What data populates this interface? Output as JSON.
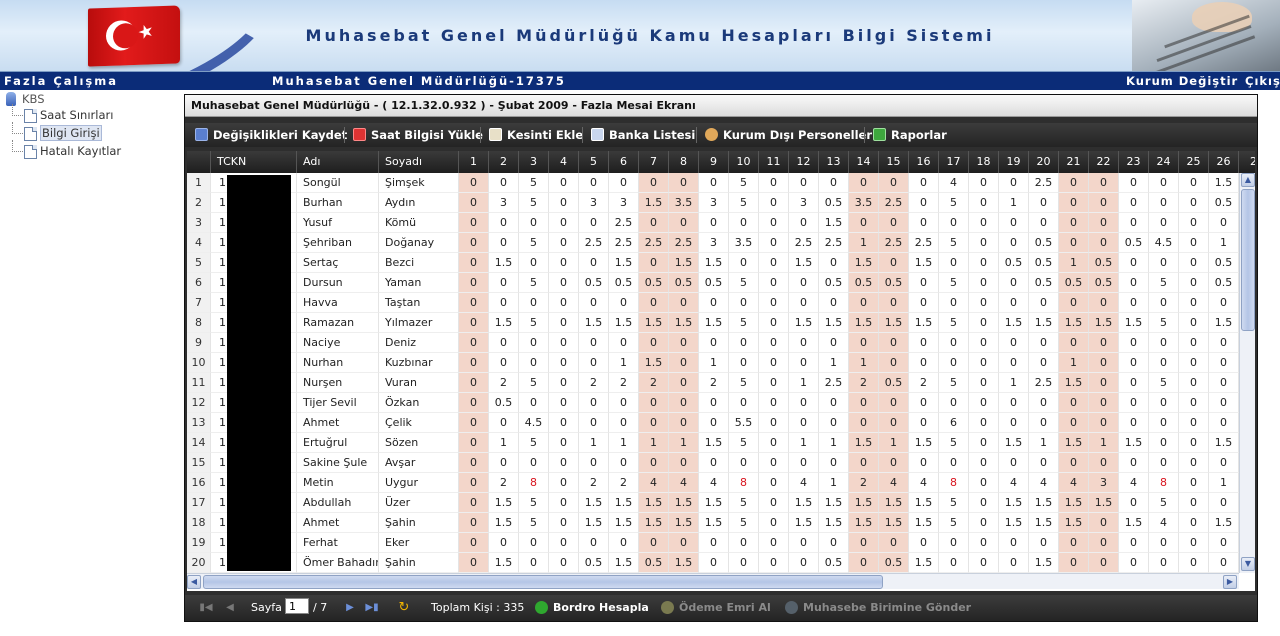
{
  "header": {
    "title": "Muhasebat Genel Müdürlüğü Kamu Hesapları Bilgi Sistemi"
  },
  "menubar": {
    "section": "Fazla Çalışma",
    "unit": "Muhasebat Genel Müdürlüğü-17375",
    "switch_label": "Kurum Değiştir",
    "exit_label": "Çıkış"
  },
  "tree": {
    "root": "KBS",
    "items": [
      "Saat Sınırları",
      "Bilgi Girişi",
      "Hatalı Kayıtlar"
    ],
    "selected": "Bilgi Girişi"
  },
  "panel": {
    "title": "Muhasebat Genel Müdürlüğü - ( 12.1.32.0.932 ) - Şubat 2009 - Fazla Mesai Ekranı"
  },
  "toolbar": {
    "save": "Değişiklikleri Kaydet",
    "load_hours": "Saat Bilgisi Yükle",
    "add_deduction": "Kesinti Ekle",
    "bank_list": "Banka Listesi",
    "external_staff": "Kurum Dışı Personeller",
    "reports": "Raporlar"
  },
  "colors": {
    "pink_cell": "#f3d6ca",
    "red_value": "#d9141e",
    "nav_blue": "#0b2c78"
  },
  "grid": {
    "headers": [
      "TCKN",
      "Adı",
      "Soyadı"
    ],
    "day_headers": [
      "1",
      "2",
      "3",
      "4",
      "5",
      "6",
      "7",
      "8",
      "9",
      "10",
      "11",
      "12",
      "13",
      "14",
      "15",
      "16",
      "17",
      "18",
      "19",
      "20",
      "21",
      "22",
      "23",
      "24",
      "25",
      "26",
      "2"
    ],
    "pink_days": [
      1,
      7,
      8,
      14,
      15,
      21,
      22
    ],
    "rows": [
      {
        "n": "1",
        "tc": "1",
        "ad": "Songül",
        "soyad": "Şimşek",
        "days": [
          "0",
          "0",
          "5",
          "0",
          "0",
          "0",
          "0",
          "0",
          "0",
          "5",
          "0",
          "0",
          "0",
          "0",
          "0",
          "0",
          "4",
          "0",
          "0",
          "2.5",
          "0",
          "0",
          "0",
          "0",
          "0",
          "1.5"
        ]
      },
      {
        "n": "2",
        "tc": "1",
        "ad": "Burhan",
        "soyad": "Aydın",
        "days": [
          "0",
          "3",
          "5",
          "0",
          "3",
          "3",
          "1.5",
          "3.5",
          "3",
          "5",
          "0",
          "3",
          "0.5",
          "3.5",
          "2.5",
          "0",
          "5",
          "0",
          "1",
          "0",
          "0",
          "0",
          "0",
          "0",
          "0",
          "0.5"
        ]
      },
      {
        "n": "3",
        "tc": "1",
        "ad": "Yusuf",
        "soyad": "Kömü",
        "days": [
          "0",
          "0",
          "0",
          "0",
          "0",
          "2.5",
          "0",
          "0",
          "0",
          "0",
          "0",
          "0",
          "1.5",
          "0",
          "0",
          "0",
          "0",
          "0",
          "0",
          "0",
          "0",
          "0",
          "0",
          "0",
          "0",
          "0"
        ]
      },
      {
        "n": "4",
        "tc": "1",
        "ad": "Şehriban",
        "soyad": "Doğanay",
        "days": [
          "0",
          "0",
          "5",
          "0",
          "2.5",
          "2.5",
          "2.5",
          "2.5",
          "3",
          "3.5",
          "0",
          "2.5",
          "2.5",
          "1",
          "2.5",
          "2.5",
          "5",
          "0",
          "0",
          "0.5",
          "0",
          "0",
          "0.5",
          "4.5",
          "0",
          "1"
        ]
      },
      {
        "n": "5",
        "tc": "1",
        "ad": "Sertaç",
        "soyad": "Bezci",
        "days": [
          "0",
          "1.5",
          "0",
          "0",
          "0",
          "1.5",
          "0",
          "1.5",
          "1.5",
          "0",
          "0",
          "1.5",
          "0",
          "1.5",
          "0",
          "1.5",
          "0",
          "0",
          "0.5",
          "0.5",
          "1",
          "0.5",
          "0",
          "0",
          "0",
          "0.5"
        ]
      },
      {
        "n": "6",
        "tc": "1",
        "ad": "Dursun",
        "soyad": "Yaman",
        "days": [
          "0",
          "0",
          "5",
          "0",
          "0.5",
          "0.5",
          "0.5",
          "0.5",
          "0.5",
          "5",
          "0",
          "0",
          "0.5",
          "0.5",
          "0.5",
          "0",
          "5",
          "0",
          "0",
          "0.5",
          "0.5",
          "0.5",
          "0",
          "5",
          "0",
          "0.5"
        ]
      },
      {
        "n": "7",
        "tc": "1",
        "ad": "Havva",
        "soyad": "Taştan",
        "days": [
          "0",
          "0",
          "0",
          "0",
          "0",
          "0",
          "0",
          "0",
          "0",
          "0",
          "0",
          "0",
          "0",
          "0",
          "0",
          "0",
          "0",
          "0",
          "0",
          "0",
          "0",
          "0",
          "0",
          "0",
          "0",
          "0"
        ]
      },
      {
        "n": "8",
        "tc": "1",
        "ad": "Ramazan",
        "soyad": "Yılmazer",
        "days": [
          "0",
          "1.5",
          "5",
          "0",
          "1.5",
          "1.5",
          "1.5",
          "1.5",
          "1.5",
          "5",
          "0",
          "1.5",
          "1.5",
          "1.5",
          "1.5",
          "1.5",
          "5",
          "0",
          "1.5",
          "1.5",
          "1.5",
          "1.5",
          "1.5",
          "5",
          "0",
          "1.5"
        ]
      },
      {
        "n": "9",
        "tc": "1",
        "ad": "Naciye",
        "soyad": "Deniz",
        "days": [
          "0",
          "0",
          "0",
          "0",
          "0",
          "0",
          "0",
          "0",
          "0",
          "0",
          "0",
          "0",
          "0",
          "0",
          "0",
          "0",
          "0",
          "0",
          "0",
          "0",
          "0",
          "0",
          "0",
          "0",
          "0",
          "0"
        ]
      },
      {
        "n": "10",
        "tc": "1",
        "ad": "Nurhan",
        "soyad": "Kuzbınar",
        "days": [
          "0",
          "0",
          "0",
          "0",
          "0",
          "1",
          "1.5",
          "0",
          "1",
          "0",
          "0",
          "0",
          "1",
          "1",
          "0",
          "0",
          "0",
          "0",
          "0",
          "0",
          "1",
          "0",
          "0",
          "0",
          "0",
          "0"
        ]
      },
      {
        "n": "11",
        "tc": "1",
        "ad": "Nurşen",
        "soyad": "Vuran",
        "days": [
          "0",
          "2",
          "5",
          "0",
          "2",
          "2",
          "2",
          "0",
          "2",
          "5",
          "0",
          "1",
          "2.5",
          "2",
          "0.5",
          "2",
          "5",
          "0",
          "1",
          "2.5",
          "1.5",
          "0",
          "0",
          "5",
          "0",
          "0"
        ]
      },
      {
        "n": "12",
        "tc": "1",
        "ad": "Tijer Sevil",
        "soyad": "Özkan",
        "days": [
          "0",
          "0.5",
          "0",
          "0",
          "0",
          "0",
          "0",
          "0",
          "0",
          "0",
          "0",
          "0",
          "0",
          "0",
          "0",
          "0",
          "0",
          "0",
          "0",
          "0",
          "0",
          "0",
          "0",
          "0",
          "0",
          "0"
        ]
      },
      {
        "n": "13",
        "tc": "1",
        "ad": "Ahmet",
        "soyad": "Çelik",
        "days": [
          "0",
          "0",
          "4.5",
          "0",
          "0",
          "0",
          "0",
          "0",
          "0",
          "5.5",
          "0",
          "0",
          "0",
          "0",
          "0",
          "0",
          "6",
          "0",
          "0",
          "0",
          "0",
          "0",
          "0",
          "0",
          "0",
          "0"
        ]
      },
      {
        "n": "14",
        "tc": "1",
        "ad": "Ertuğrul",
        "soyad": "Sözen",
        "days": [
          "0",
          "1",
          "5",
          "0",
          "1",
          "1",
          "1",
          "1",
          "1.5",
          "5",
          "0",
          "1",
          "1",
          "1.5",
          "1",
          "1.5",
          "5",
          "0",
          "1.5",
          "1",
          "1.5",
          "1",
          "1.5",
          "0",
          "0",
          "1.5"
        ]
      },
      {
        "n": "15",
        "tc": "1",
        "ad": "Sakine Şule",
        "soyad": "Avşar",
        "days": [
          "0",
          "0",
          "0",
          "0",
          "0",
          "0",
          "0",
          "0",
          "0",
          "0",
          "0",
          "0",
          "0",
          "0",
          "0",
          "0",
          "0",
          "0",
          "0",
          "0",
          "0",
          "0",
          "0",
          "0",
          "0",
          "0"
        ]
      },
      {
        "n": "16",
        "tc": "1",
        "ad": "Metin",
        "soyad": "Uygur",
        "days": [
          "0",
          "2",
          "8",
          "0",
          "2",
          "2",
          "4",
          "4",
          "4",
          "8",
          "0",
          "4",
          "1",
          "2",
          "4",
          "4",
          "8",
          "0",
          "4",
          "4",
          "4",
          "3",
          "4",
          "8",
          "0",
          "1"
        ]
      },
      {
        "n": "17",
        "tc": "1",
        "ad": "Abdullah",
        "soyad": "Üzer",
        "days": [
          "0",
          "1.5",
          "5",
          "0",
          "1.5",
          "1.5",
          "1.5",
          "1.5",
          "1.5",
          "5",
          "0",
          "1.5",
          "1.5",
          "1.5",
          "1.5",
          "1.5",
          "5",
          "0",
          "1.5",
          "1.5",
          "1.5",
          "1.5",
          "0",
          "5",
          "0",
          "0"
        ]
      },
      {
        "n": "18",
        "tc": "1",
        "ad": "Ahmet",
        "soyad": "Şahin",
        "days": [
          "0",
          "1.5",
          "5",
          "0",
          "1.5",
          "1.5",
          "1.5",
          "1.5",
          "1.5",
          "5",
          "0",
          "1.5",
          "1.5",
          "1.5",
          "1.5",
          "1.5",
          "5",
          "0",
          "1.5",
          "1.5",
          "1.5",
          "0",
          "1.5",
          "4",
          "0",
          "1.5"
        ]
      },
      {
        "n": "19",
        "tc": "1",
        "ad": "Ferhat",
        "soyad": "Eker",
        "days": [
          "0",
          "0",
          "0",
          "0",
          "0",
          "0",
          "0",
          "0",
          "0",
          "0",
          "0",
          "0",
          "0",
          "0",
          "0",
          "0",
          "0",
          "0",
          "0",
          "0",
          "0",
          "0",
          "0",
          "0",
          "0",
          "0"
        ]
      },
      {
        "n": "20",
        "tc": "1",
        "ad": "Ömer Bahadır",
        "soyad": "Şahin",
        "days": [
          "0",
          "1.5",
          "0",
          "0",
          "0.5",
          "1.5",
          "0.5",
          "1.5",
          "0",
          "0",
          "0",
          "0",
          "0.5",
          "0",
          "0.5",
          "1.5",
          "0",
          "0",
          "0",
          "1.5",
          "0",
          "0",
          "0",
          "0",
          "0",
          "0"
        ]
      }
    ],
    "red_cells": [
      [
        15,
        2
      ],
      [
        15,
        9
      ],
      [
        15,
        16
      ],
      [
        15,
        23
      ]
    ]
  },
  "pager": {
    "page_label": "Sayfa",
    "page_value": "1",
    "page_total": "/ 7",
    "total_label": "Toplam Kişi : 335",
    "payroll": "Bordro Hesapla",
    "payment_order": "Ödeme Emri Al",
    "send_accounting": "Muhasebe Birimine Gönder"
  }
}
